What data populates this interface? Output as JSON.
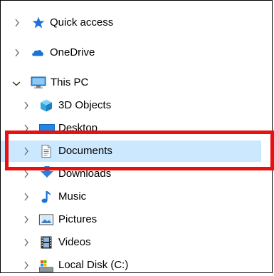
{
  "nav_pane": {
    "items": [
      {
        "label": "Quick access",
        "icon": "pin-star-icon",
        "expanded": false
      },
      {
        "label": "OneDrive",
        "icon": "cloud-icon",
        "expanded": false
      },
      {
        "label": "This PC",
        "icon": "monitor-icon",
        "expanded": true
      },
      {
        "label": "3D Objects",
        "icon": "cube-icon",
        "expanded": false
      },
      {
        "label": "Desktop",
        "icon": "desktop-icon",
        "expanded": false
      },
      {
        "label": "Documents",
        "icon": "document-icon",
        "expanded": false,
        "selected": true
      },
      {
        "label": "Downloads",
        "icon": "download-arrow-icon",
        "expanded": false
      },
      {
        "label": "Music",
        "icon": "music-note-icon",
        "expanded": false
      },
      {
        "label": "Pictures",
        "icon": "picture-icon",
        "expanded": false
      },
      {
        "label": "Videos",
        "icon": "film-icon",
        "expanded": false
      },
      {
        "label": "Local Disk (C:)",
        "icon": "drive-icon",
        "expanded": false
      }
    ]
  },
  "colors": {
    "selection": "#cce8ff",
    "annotation": "#e81010",
    "chevron": "#6e6e6e"
  }
}
